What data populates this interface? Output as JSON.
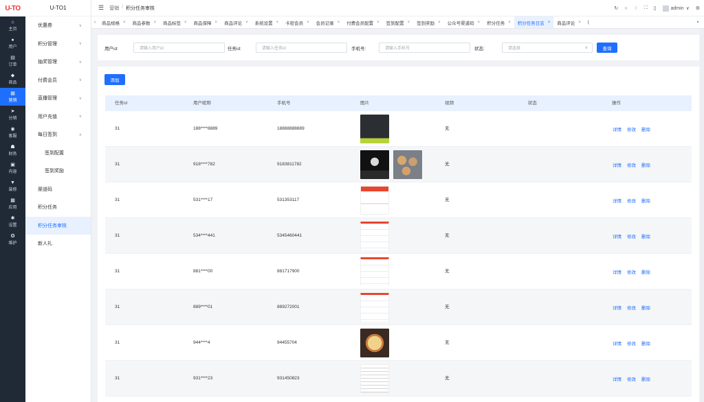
{
  "brand": {
    "logo": "U-TO",
    "subtitle": "U-TO1"
  },
  "rail": [
    {
      "label": "主页",
      "icon": "home-icon",
      "glyph": "⌂"
    },
    {
      "label": "用户",
      "icon": "user-icon",
      "glyph": "●"
    },
    {
      "label": "订单",
      "icon": "order-icon",
      "glyph": "▤"
    },
    {
      "label": "商品",
      "icon": "goods-icon",
      "glyph": "◆"
    },
    {
      "label": "营销",
      "icon": "marketing-icon",
      "glyph": "▦",
      "active": true
    },
    {
      "label": "分销",
      "icon": "distribution-icon",
      "glyph": "➤"
    },
    {
      "label": "客服",
      "icon": "service-icon",
      "glyph": "◉"
    },
    {
      "label": "财务",
      "icon": "finance-icon",
      "glyph": "☗"
    },
    {
      "label": "内容",
      "icon": "content-icon",
      "glyph": "▣"
    },
    {
      "label": "装修",
      "icon": "decoration-icon",
      "glyph": "▼"
    },
    {
      "label": "应用",
      "icon": "apps-icon",
      "glyph": "▩"
    },
    {
      "label": "设置",
      "icon": "settings-icon",
      "glyph": "✱"
    },
    {
      "label": "维护",
      "icon": "maintenance-icon",
      "glyph": "✪"
    }
  ],
  "submenu": [
    {
      "label": "优惠券",
      "chevron": "down",
      "name": "coupon"
    },
    {
      "label": "积分管理",
      "chevron": "down",
      "name": "points"
    },
    {
      "label": "抽奖管理",
      "chevron": "down",
      "name": "lottery"
    },
    {
      "label": "付费会员",
      "chevron": "down",
      "name": "paid-member"
    },
    {
      "label": "直播管理",
      "chevron": "down",
      "name": "live"
    },
    {
      "label": "用户充值",
      "chevron": "down",
      "name": "recharge"
    },
    {
      "label": "每日签到",
      "chevron": "up",
      "name": "daily-signin"
    },
    {
      "label": "签到配置",
      "child": true,
      "name": "signin-config"
    },
    {
      "label": "签到奖励",
      "child": true,
      "name": "signin-reward"
    },
    {
      "label": "渠道码",
      "name": "channel-code"
    },
    {
      "label": "积分任务",
      "name": "points-task"
    },
    {
      "label": "积分任务审核",
      "active": true,
      "name": "points-task-review"
    },
    {
      "label": "新人礼",
      "name": "newcomer-gift"
    }
  ],
  "breadcrumb": [
    "营销",
    "积分任务审核"
  ],
  "header": {
    "user": "admin"
  },
  "tabs": [
    "商品规格",
    "商品参数",
    "商品标签",
    "商品保障",
    "商品评论",
    "系统设置",
    "卡密会员",
    "会员记录",
    "付费会员配置",
    "签到配置",
    "签到奖励",
    "公众号渠道码",
    "积分任务",
    "积分任务日志",
    "商品评论",
    "("
  ],
  "active_tab": 13,
  "filter": {
    "user_id_label": "用户id:",
    "user_id_placeholder": "请输入用户id",
    "task_id_label": "任务id:",
    "task_id_placeholder": "请输入任务id",
    "phone_label": "手机号:",
    "phone_placeholder": "请输入手机号",
    "status_label": "状态:",
    "status_placeholder": "请选择",
    "query_label": "查询"
  },
  "add_label": "添加",
  "table": {
    "columns": [
      "任务id",
      "用户昵称",
      "手机号",
      "图片",
      "视频",
      "状态",
      "操作"
    ],
    "ops": [
      "详情",
      "修改",
      "删除"
    ],
    "rows": [
      {
        "task_id": "31",
        "nickname": "188****8889",
        "phone": "18888888889",
        "video": "无",
        "status": "",
        "images": [
          "dark-app"
        ]
      },
      {
        "task_id": "31",
        "nickname": "918****782",
        "phone": "9183811782",
        "video": "无",
        "status": "",
        "images": [
          "dark-logo",
          "food-photo"
        ]
      },
      {
        "task_id": "31",
        "nickname": "531****17",
        "phone": "531353117",
        "video": "无",
        "status": "",
        "images": [
          "red-app"
        ]
      },
      {
        "task_id": "31",
        "nickname": "534****441",
        "phone": "5345460441",
        "video": "无",
        "status": "",
        "images": [
          "list-app"
        ]
      },
      {
        "task_id": "31",
        "nickname": "881****00",
        "phone": "881717900",
        "video": "无",
        "status": "",
        "images": [
          "list-app"
        ]
      },
      {
        "task_id": "31",
        "nickname": "889****01",
        "phone": "889272001",
        "video": "无",
        "status": "",
        "images": [
          "list-app"
        ]
      },
      {
        "task_id": "31",
        "nickname": "944****4",
        "phone": "94455704",
        "video": "无",
        "status": "",
        "images": [
          "pizza-photo"
        ]
      },
      {
        "task_id": "31",
        "nickname": "931****23",
        "phone": "931450823",
        "video": "无",
        "status": "",
        "images": [
          "receipt"
        ]
      }
    ]
  },
  "colors": {
    "accent": "#1f6fff",
    "rail": "#202a36",
    "header_row": "#e8f1ff"
  }
}
